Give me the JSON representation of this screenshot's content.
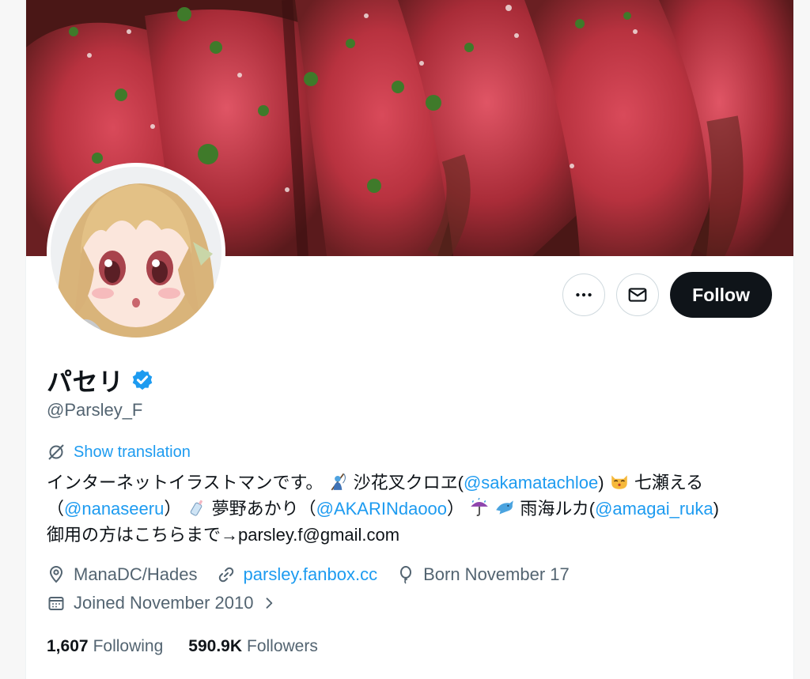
{
  "profile": {
    "display_name": "パセリ",
    "handle": "@Parsley_F",
    "verified_icon": "verified-badge-icon",
    "show_translation": "Show translation",
    "bio": {
      "line1_text": "インターネットイラストマンです。",
      "emoji1": "person-with-fishing-rod-emoji",
      "name1": "沙花叉クロヱ(",
      "link1": "@sakamatachloe",
      "close1": ")",
      "emoji2": "kissing-cat-emoji",
      "name2": "七瀬える",
      "open2": "（",
      "link2": "@nanaseeru",
      "close2": "）",
      "emoji3": "baby-bottle-emoji",
      "name3": "夢野あかり（",
      "link3": "@AKARINdaooo",
      "close3": "）",
      "emoji4": "umbrella-with-rain-emoji",
      "emoji5": "dolphin-emoji",
      "name4": "雨海ルカ(",
      "link4": "@amagai_ruka",
      "close4": ")",
      "line3": "御用の方はこちらまで→parsley.f@gmail.com"
    },
    "location": "ManaDC/Hades",
    "website": "parsley.fanbox.cc",
    "birthday": "Born November 17",
    "joined": "Joined November 2010",
    "following_count": "1,607",
    "following_label": "Following",
    "followers_count": "590.9K",
    "followers_label": "Followers"
  },
  "actions": {
    "more_icon": "more-icon",
    "message_icon": "envelope-icon",
    "follow_label": "Follow"
  },
  "colors": {
    "accent": "#1d9bf0",
    "text": "#0f1419",
    "secondary": "#536471",
    "follow_bg": "#0f1419"
  }
}
